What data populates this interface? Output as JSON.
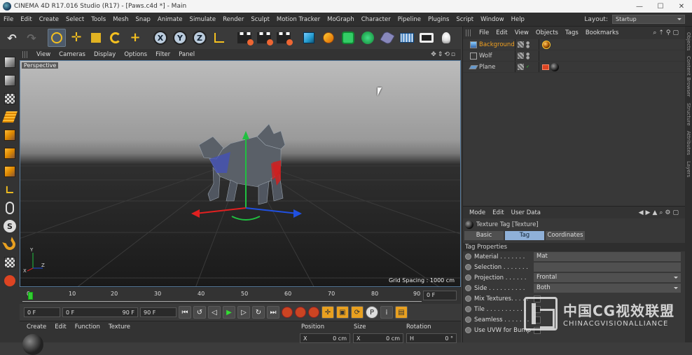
{
  "window": {
    "title": "CINEMA 4D R17.016 Studio (R17) - [Paws.c4d *] - Main",
    "min": "—",
    "max": "☐",
    "close": "✕"
  },
  "menubar": {
    "items": [
      "File",
      "Edit",
      "Create",
      "Select",
      "Tools",
      "Mesh",
      "Snap",
      "Animate",
      "Simulate",
      "Render",
      "Sculpt",
      "Motion Tracker",
      "MoGraph",
      "Character",
      "Pipeline",
      "Plugins",
      "Script",
      "Window",
      "Help"
    ],
    "layout_label": "Layout:",
    "layout_value": "Startup"
  },
  "toolbar": {
    "axis_x": "X",
    "axis_y": "Y",
    "axis_z": "Z"
  },
  "viewport": {
    "menu": [
      "View",
      "Cameras",
      "Display",
      "Options",
      "Filter",
      "Panel"
    ],
    "camera_label": "Perspective",
    "grid_spacing": "Grid Spacing : 1000 cm"
  },
  "timeline": {
    "ticks": [
      "0",
      "10",
      "20",
      "30",
      "40",
      "50",
      "60",
      "70",
      "80",
      "90"
    ],
    "current_frame": "0 F"
  },
  "transport": {
    "start": "0 F",
    "range_start": "0 F",
    "range_end": "90 F",
    "end": "90 F"
  },
  "material_manager": {
    "menu": [
      "Create",
      "Edit",
      "Function",
      "Texture"
    ]
  },
  "coordinates": {
    "headers": [
      "Position",
      "Size",
      "Rotation"
    ],
    "values": [
      {
        "axis": "X",
        "val": "0 cm"
      },
      {
        "axis": "X",
        "val": "0 cm"
      },
      {
        "axis": "H",
        "val": "0 °"
      }
    ]
  },
  "object_manager": {
    "menu": [
      "File",
      "Edit",
      "View",
      "Objects",
      "Tags",
      "Bookmarks"
    ],
    "objects": [
      {
        "name": "Background",
        "selected": true
      },
      {
        "name": "Wolf",
        "selected": false
      },
      {
        "name": "Plane",
        "selected": false
      }
    ]
  },
  "attribute_manager": {
    "menu": [
      "Mode",
      "Edit",
      "User Data"
    ],
    "title": "Texture Tag [Texture]",
    "tabs": [
      "Basic",
      "Tag",
      "Coordinates"
    ],
    "section": "Tag Properties",
    "rows": [
      {
        "label": "Material . . . . . . .",
        "value": "Mat"
      },
      {
        "label": "Selection . . . . . . .",
        "value": ""
      },
      {
        "label": "Projection . . . . . .",
        "value": "Frontal"
      },
      {
        "label": "Side . . . . . . . . . .",
        "value": "Both"
      },
      {
        "label": "Mix Textures. . . . .",
        "value": ""
      },
      {
        "label": "Tile . . . . . . . . . . .",
        "value": ""
      },
      {
        "label": "Seamless . . . . . . .",
        "value": ""
      },
      {
        "label": "Use UVW for Bump",
        "value": ""
      }
    ]
  },
  "side_tabs": [
    "Objects",
    "Content Browser",
    "Structure",
    "Attributes",
    "Layers"
  ],
  "watermark": {
    "line1": "中国CG视效联盟",
    "line2": "CHINACGVISIONALLIANCE"
  },
  "colors": {
    "accent_blue": "#8fb0d8",
    "selected_orange": "#f0a020",
    "axis_red": "#e02020",
    "axis_green": "#20c040",
    "axis_blue": "#2050e0"
  }
}
